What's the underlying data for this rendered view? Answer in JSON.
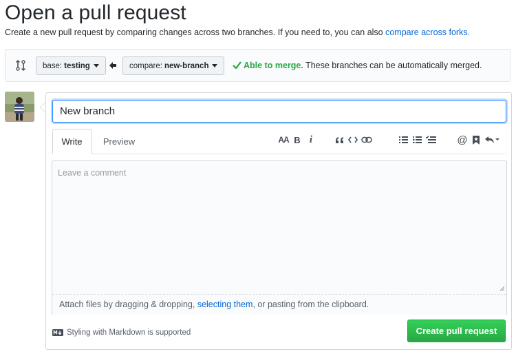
{
  "header": {
    "title": "Open a pull request",
    "description": "Create a new pull request by comparing changes across two branches. If you need to, you can also ",
    "forks_link": "compare across forks."
  },
  "range": {
    "base_prefix": "base:",
    "base_branch": "testing",
    "compare_prefix": "compare:",
    "compare_branch": "new-branch",
    "merge_status": "Able to merge.",
    "merge_detail": " These branches can be automatically merged."
  },
  "compose": {
    "title_value": "New branch",
    "tabs": [
      {
        "label": "Write",
        "selected": true
      },
      {
        "label": "Preview",
        "selected": false
      }
    ],
    "toolbar": {
      "header_label": "AA",
      "bold_label": "B",
      "italic_label": "i",
      "mention_label": "@",
      "icons": [
        "header-icon",
        "bold-icon",
        "italic-icon",
        "quote-icon",
        "code-icon",
        "link-icon",
        "unordered-list-icon",
        "ordered-list-icon",
        "task-list-icon",
        "mention-icon",
        "bookmark-icon",
        "reply-icon"
      ]
    },
    "comment_placeholder": "Leave a comment",
    "attach_prefix": "Attach files by dragging & dropping, ",
    "attach_link": "selecting them",
    "attach_suffix": ", or pasting from the clipboard.",
    "markdown_note": "Styling with Markdown is supported",
    "submit_label": "Create pull request"
  },
  "colors": {
    "link": "#0366d6",
    "success": "#28a745",
    "focus": "#2188ff"
  }
}
